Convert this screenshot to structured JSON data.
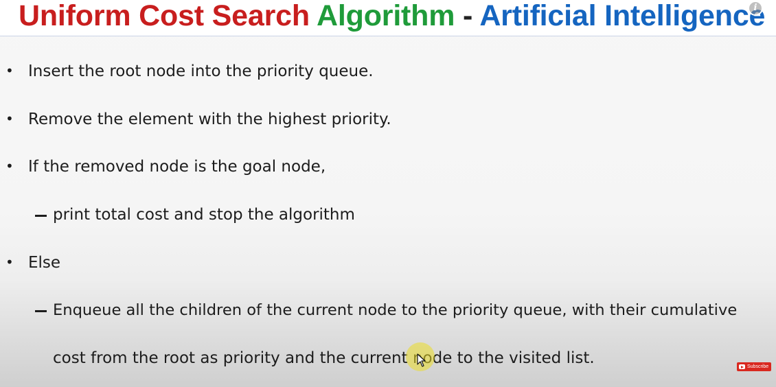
{
  "slide": {
    "title": {
      "part1": "Uniform Cost Search",
      "part2": "Algorithm",
      "separator": "-",
      "part3": "Artificial Intelligence"
    },
    "lines": [
      {
        "type": "bullet",
        "marker": "•",
        "text": "Insert the root node into the priority queue."
      },
      {
        "type": "bullet",
        "marker": "•",
        "text": "Remove the element with the highest priority."
      },
      {
        "type": "bullet",
        "marker": "•",
        "text": "If the removed node is the goal node,"
      },
      {
        "type": "sub",
        "marker": "–",
        "text": "print total cost and stop the algorithm"
      },
      {
        "type": "bullet",
        "marker": "•",
        "text": "Else"
      },
      {
        "type": "sub",
        "marker": "–",
        "text": "Enqueue all the children of the current node to the priority queue, with their cumulative"
      },
      {
        "type": "continuation",
        "marker": "",
        "text": "cost from the root as priority and the current node to the visited list."
      }
    ]
  },
  "overlay": {
    "info_icon": "info-icon",
    "info_glyph": "i",
    "subscribe_label": "Subscribe",
    "subscribe_icon": "youtube-play-icon",
    "cursor_icon": "cursor-arrow-icon"
  },
  "colors": {
    "title_red": "#c81e1e",
    "title_green": "#1f9b3a",
    "title_blue": "#1565c0",
    "subscribe_red": "#d9281f",
    "cursor_highlight": "#ebdc28"
  }
}
